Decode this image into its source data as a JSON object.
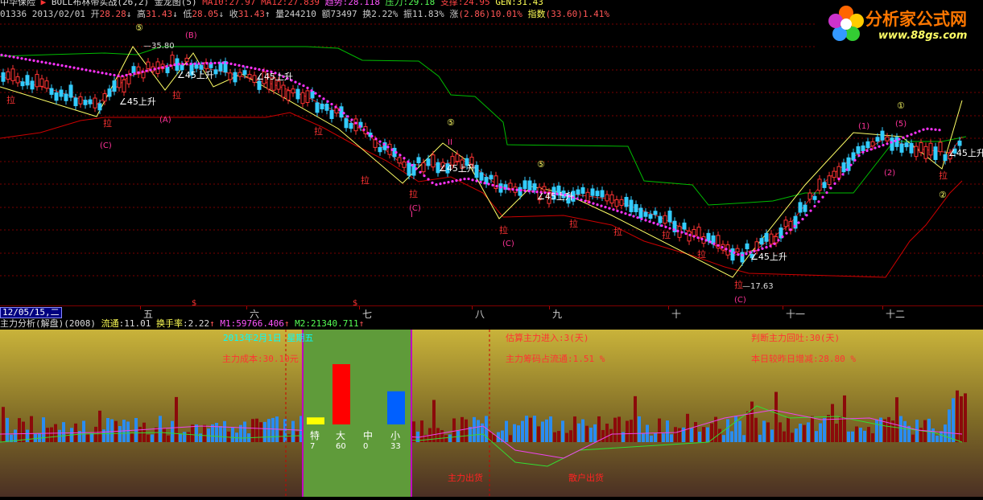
{
  "info_line1": {
    "name": "中华保险",
    "items": [
      "BOLL布林带实战(26,2)",
      "金龙图(5)",
      "MA10:27.97",
      "MA12:27.839",
      "趋势:28.118",
      "压力:29.18",
      "支撑:24.95",
      "GEN:31.43"
    ]
  },
  "info_line2": {
    "code": "01336",
    "date": "2013/02/01",
    "open_label": "开",
    "open": "28.28",
    "high_label": "高",
    "high": "31.43",
    "low_label": "低",
    "low": "28.05",
    "close_label": "收",
    "close": "31.43",
    "vol_label": "量",
    "vol": "244210",
    "amt_label": "额",
    "amt": "73497",
    "turnover_label": "换",
    "turnover": "2.22%",
    "amp_label": "振",
    "amp": "11.83%",
    "chg_label": "涨",
    "chg": "(2.86)10.01%",
    "index_label": "指数",
    "index": "(33.60)1.41%"
  },
  "logo": {
    "title": "分析家公式网",
    "url": "www.88gs.com"
  },
  "price_labels": {
    "high": "35.80",
    "low": "17.63"
  },
  "annotations": {
    "up45": "∠45上升",
    "la": "拉",
    "wave_c": "(C)",
    "wave_a": "(A)",
    "wave_b": "(B)",
    "wave_1": "(1)",
    "wave_2": "(2)",
    "wave_5": "(5)",
    "circ5": "⑤",
    "circ1": "①",
    "circ2": "②",
    "ii": "II",
    "i": "I",
    "dollar": "$"
  },
  "axis": {
    "date": "12/05/15,二",
    "months": [
      "五",
      "六",
      "七",
      "八",
      "九",
      "十",
      "十一",
      "十二"
    ]
  },
  "lower_title": {
    "name": "主力分析(解盘)(2008)",
    "float_label": "流通",
    "float_val": ":11.01",
    "turnover_label": "换手率",
    "turnover_val": ":2.22",
    "m1_label": "M1",
    "m1_val": ":59766.406",
    "m2_label": "M2",
    "m2_val": ":21340.711"
  },
  "lower_texts": {
    "cost": "主力成本:30.10元",
    "week": "2013年2月1日 星期五",
    "est_entry": "估算主力进入:3(天)",
    "chip_ratio": "主力筹码占流通:1.51 %",
    "judge": "判断主力回吐:30(天)",
    "increase": "本日较昨日增减:28.80 %",
    "bottom_left": "主力出货",
    "bottom_mid": "散户出货"
  },
  "panel_bars": {
    "labels": [
      "特",
      "大",
      "中",
      "小"
    ],
    "values": [
      7,
      60,
      0,
      33
    ],
    "colors": [
      "#ffff00",
      "#ff0000",
      "#00ff00",
      "#0060ff"
    ]
  },
  "colors": {
    "up": "#ff3333",
    "down": "#33ccff",
    "dots": "#ff33ff",
    "boll": "#cc0000",
    "support": "#00cc00",
    "ma": "#ffff66"
  }
}
